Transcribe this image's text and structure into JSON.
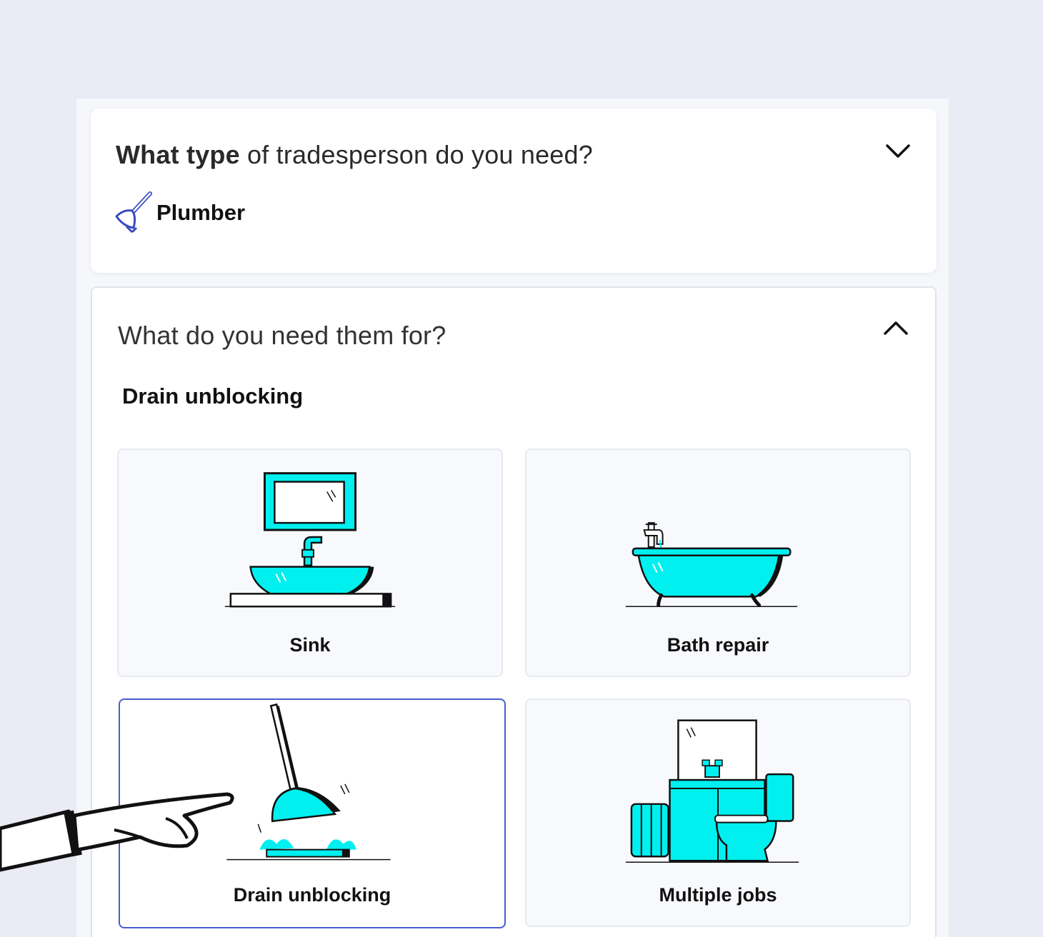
{
  "question1": {
    "bold": "What type",
    "rest": " of tradesperson do you need?",
    "answer": "Plumber",
    "answer_icon": "plunger-icon",
    "toggle_icon": "chevron-down-icon"
  },
  "question2": {
    "text": "What do you need them for?",
    "selected_value": "Drain unblocking",
    "toggle_icon": "chevron-up-icon",
    "options": [
      {
        "label": "Sink",
        "icon": "sink-icon",
        "selected": false
      },
      {
        "label": "Bath repair",
        "icon": "bathtub-icon",
        "selected": false
      },
      {
        "label": "Drain unblocking",
        "icon": "plunger-drain-icon",
        "selected": true
      },
      {
        "label": "Multiple jobs",
        "icon": "bathroom-icon",
        "selected": false
      }
    ]
  },
  "colors": {
    "accent": "#00f0f0",
    "selected_border": "#4a5bd0",
    "background": "#ebebf6"
  }
}
